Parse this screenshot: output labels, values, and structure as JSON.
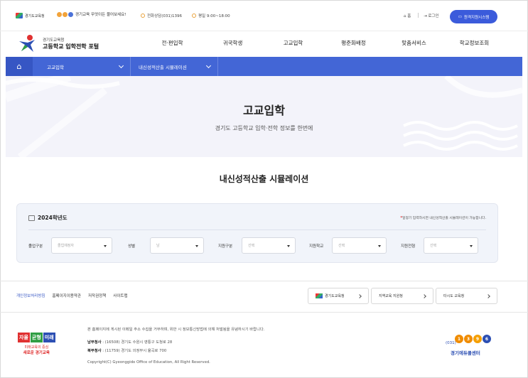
{
  "topbar": {
    "office_logo": "경기도교육청",
    "promo_text": "경기교육 무엇이든 물어보세요!",
    "phone": "전화상담(031)1396",
    "hours": "평일 9:00~18:00",
    "home": "홈",
    "login": "로그인",
    "admin_button": "원격지원시스템"
  },
  "brand": {
    "line1": "경기도교육청",
    "line2": "고등학교 입학전학 포털"
  },
  "nav": {
    "items": [
      "전·편입학",
      "귀국학생",
      "고교입학",
      "평준화배정",
      "맞춤서비스",
      "학교정보조회"
    ]
  },
  "breadcrumb": {
    "level1": "고교입학",
    "level2": "내신성적산출 시뮬레이션"
  },
  "hero": {
    "title": "고교입학",
    "subtitle": "경기도 고등학교 입학·전학 정보를 한번에"
  },
  "section_title": "내신성적산출 시뮬레이션",
  "simulator": {
    "year": "2024학년도",
    "note_star": "*",
    "note": "일정기 입력하시면 내신성적산출 시뮬레이션이 가능합니다.",
    "fields": [
      {
        "label": "졸업구분",
        "value": "졸업예정자"
      },
      {
        "label": "성별",
        "value": "남"
      },
      {
        "label": "지원구분",
        "value": "선택"
      },
      {
        "label": "지원학교",
        "value": "선택"
      },
      {
        "label": "지원전형",
        "value": "선택"
      }
    ]
  },
  "footer_links": [
    "개인정보처리방침",
    "홈페이지이용약관",
    "저작권정책",
    "사이트맵"
  ],
  "footer_buttons": [
    "경기도교육청",
    "지역교육 지원청",
    "타시도 교육청"
  ],
  "footer": {
    "logo_words": [
      "자율",
      "균형",
      "미래"
    ],
    "logo_sub": "미래교육의 중심",
    "logo_sub2": "새로운 경기교육",
    "notice": "본 홈페이지에 게시된 이메일 주소 수집을 거부하며, 위반 시 정보통신망법에 의해 처벌됨을 유념하시기 바랍니다.",
    "south_label": "남부청사",
    "south_addr": ": (16508) 경기도 수원시 영통구 도청로 28",
    "north_label": "북부청사",
    "north_addr": ": (11759) 경기도 의정부시 율곡로 700",
    "copyright": "Copyright(C) Gyeonggido Office of Education, All Right Reserved.",
    "center_area": "(031)",
    "center_digits": [
      "1",
      "3",
      "9",
      "6"
    ],
    "center_name": "경기에듀콜센터"
  },
  "colors": {
    "accent": "#4366d6",
    "button": "#3b5bdb",
    "hero_bg": "#f3f3fa",
    "sim_bg": "#f1f4fa"
  }
}
